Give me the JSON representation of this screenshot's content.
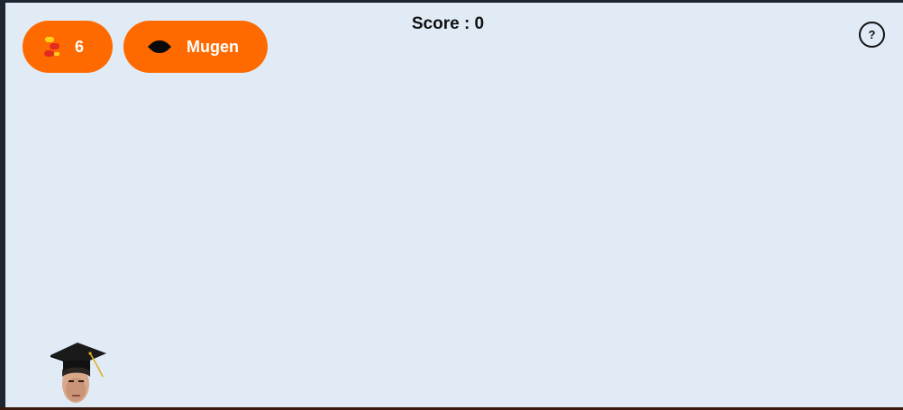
{
  "hud": {
    "lives_count": "6",
    "mode_label": "Mugen",
    "score_text": "Score : 0",
    "help_label": "?"
  },
  "icons": {
    "lives": "candy-icon",
    "mode": "dark-blob-icon",
    "help": "question-icon",
    "player": "graduate-character"
  },
  "colors": {
    "accent": "#ff6a00",
    "background": "#e0ebf6",
    "frame": "#1f2533",
    "text": "#111111"
  }
}
